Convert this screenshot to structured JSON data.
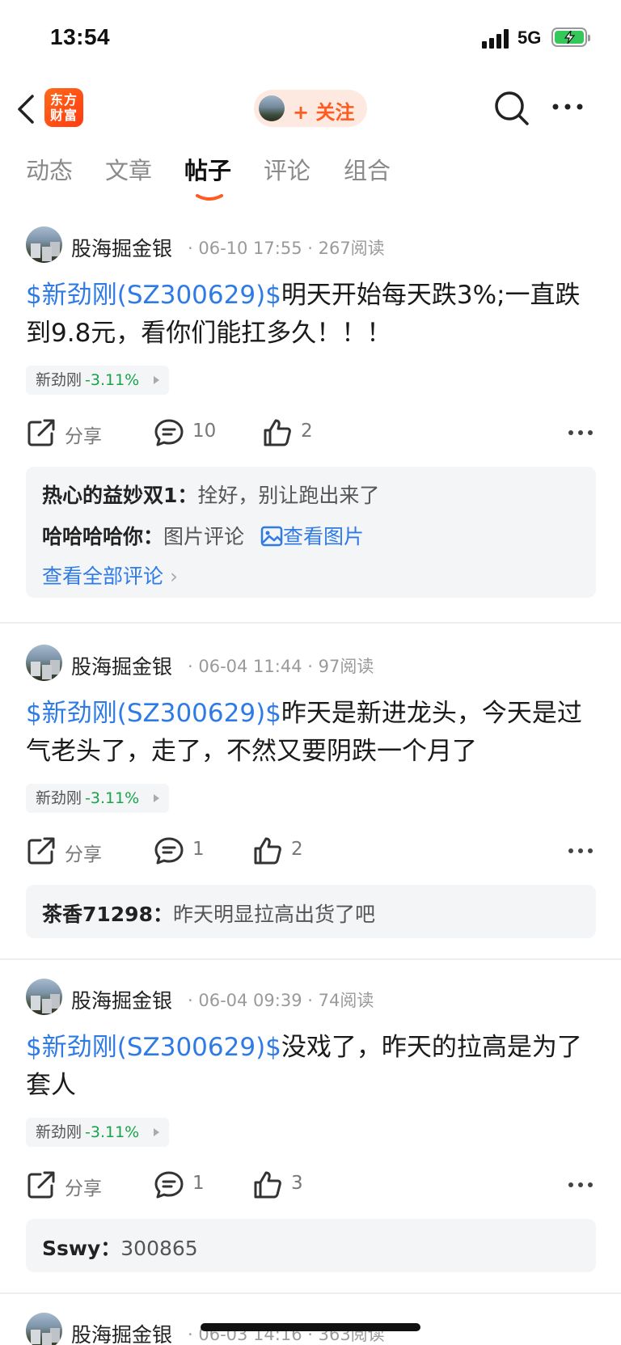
{
  "status_bar": {
    "time": "13:54",
    "network": "5G"
  },
  "header": {
    "logo_text": "东方\n财富",
    "follow_label": "+ 关注"
  },
  "tabs": [
    {
      "label": "动态",
      "active": false
    },
    {
      "label": "文章",
      "active": false
    },
    {
      "label": "帖子",
      "active": true
    },
    {
      "label": "评论",
      "active": false
    },
    {
      "label": "组合",
      "active": false
    }
  ],
  "posts": [
    {
      "author": "股海掘金银",
      "meta": "· 06-10 17:55 · 267阅读",
      "tag": "$新劲刚(SZ300629)$",
      "text": "明天开始每天跌3%;一直跌到9.8元，看你们能扛多久！！！",
      "stock_name": "新劲刚",
      "stock_change": "-3.11%",
      "share_label": "分享",
      "comments": "10",
      "likes": "2",
      "comment_preview": [
        {
          "user": "热心的益妙双1：",
          "text": "拴好，别让跑出来了",
          "link": ""
        },
        {
          "user": "哈哈哈哈你：",
          "text": "图片评论",
          "link": "查看图片"
        }
      ],
      "view_all": "查看全部评论"
    },
    {
      "author": "股海掘金银",
      "meta": "· 06-04 11:44 · 97阅读",
      "tag": "$新劲刚(SZ300629)$",
      "text": "昨天是新进龙头，今天是过气老头了，走了，不然又要阴跌一个月了",
      "stock_name": "新劲刚",
      "stock_change": "-3.11%",
      "share_label": "分享",
      "comments": "1",
      "likes": "2",
      "comment_preview": [
        {
          "user": "茶香71298：",
          "text": "昨天明显拉高出货了吧",
          "link": ""
        }
      ]
    },
    {
      "author": "股海掘金银",
      "meta": "· 06-04 09:39 · 74阅读",
      "tag": "$新劲刚(SZ300629)$",
      "text": "没戏了，昨天的拉高是为了套人",
      "stock_name": "新劲刚",
      "stock_change": "-3.11%",
      "share_label": "分享",
      "comments": "1",
      "likes": "3",
      "comment_preview": [
        {
          "user": "Sswy：",
          "text": "300865",
          "link": ""
        }
      ]
    },
    {
      "author": "股海掘金银",
      "meta": "· 06-03 14:16 · 363阅读"
    }
  ],
  "colors": {
    "accent": "#ff5a1f",
    "link": "#2f7be6",
    "down": "#17a34a"
  }
}
